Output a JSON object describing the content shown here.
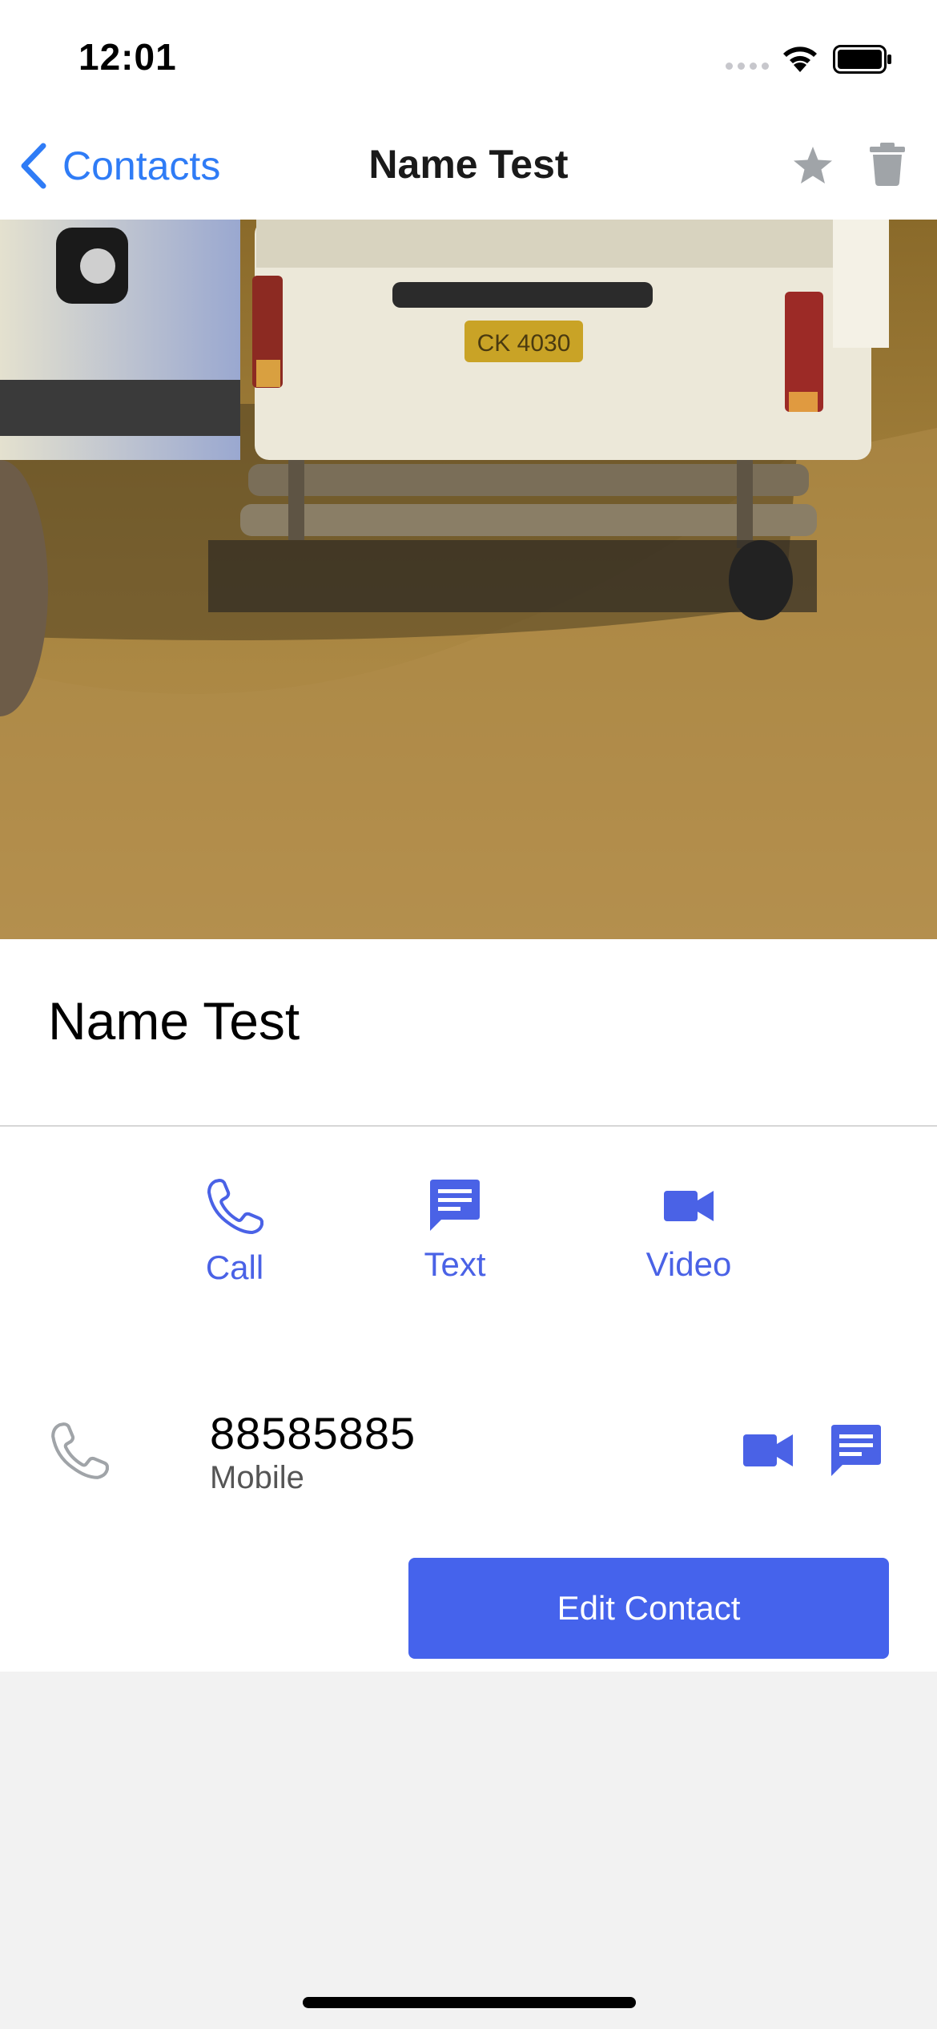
{
  "status_bar": {
    "time": "12:01"
  },
  "nav": {
    "back_label": "Contacts",
    "title": "Name Test"
  },
  "contact": {
    "name": "Name Test",
    "photo_description": "",
    "phone": {
      "number": "88585885",
      "type": "Mobile"
    }
  },
  "actions": {
    "call_label": "Call",
    "text_label": "Text",
    "video_label": "Video"
  },
  "edit_button_label": "Edit Contact",
  "icons": {
    "back": "chevron-left-icon",
    "star": "star-icon",
    "trash": "trash-icon",
    "call": "phone-icon",
    "text": "message-icon",
    "video": "video-camera-icon"
  },
  "colors": {
    "accent_blue": "#4563ec",
    "nav_blue": "#2f7cf6",
    "icon_gray": "#a0a4a8",
    "background": "#f2f2f2"
  }
}
